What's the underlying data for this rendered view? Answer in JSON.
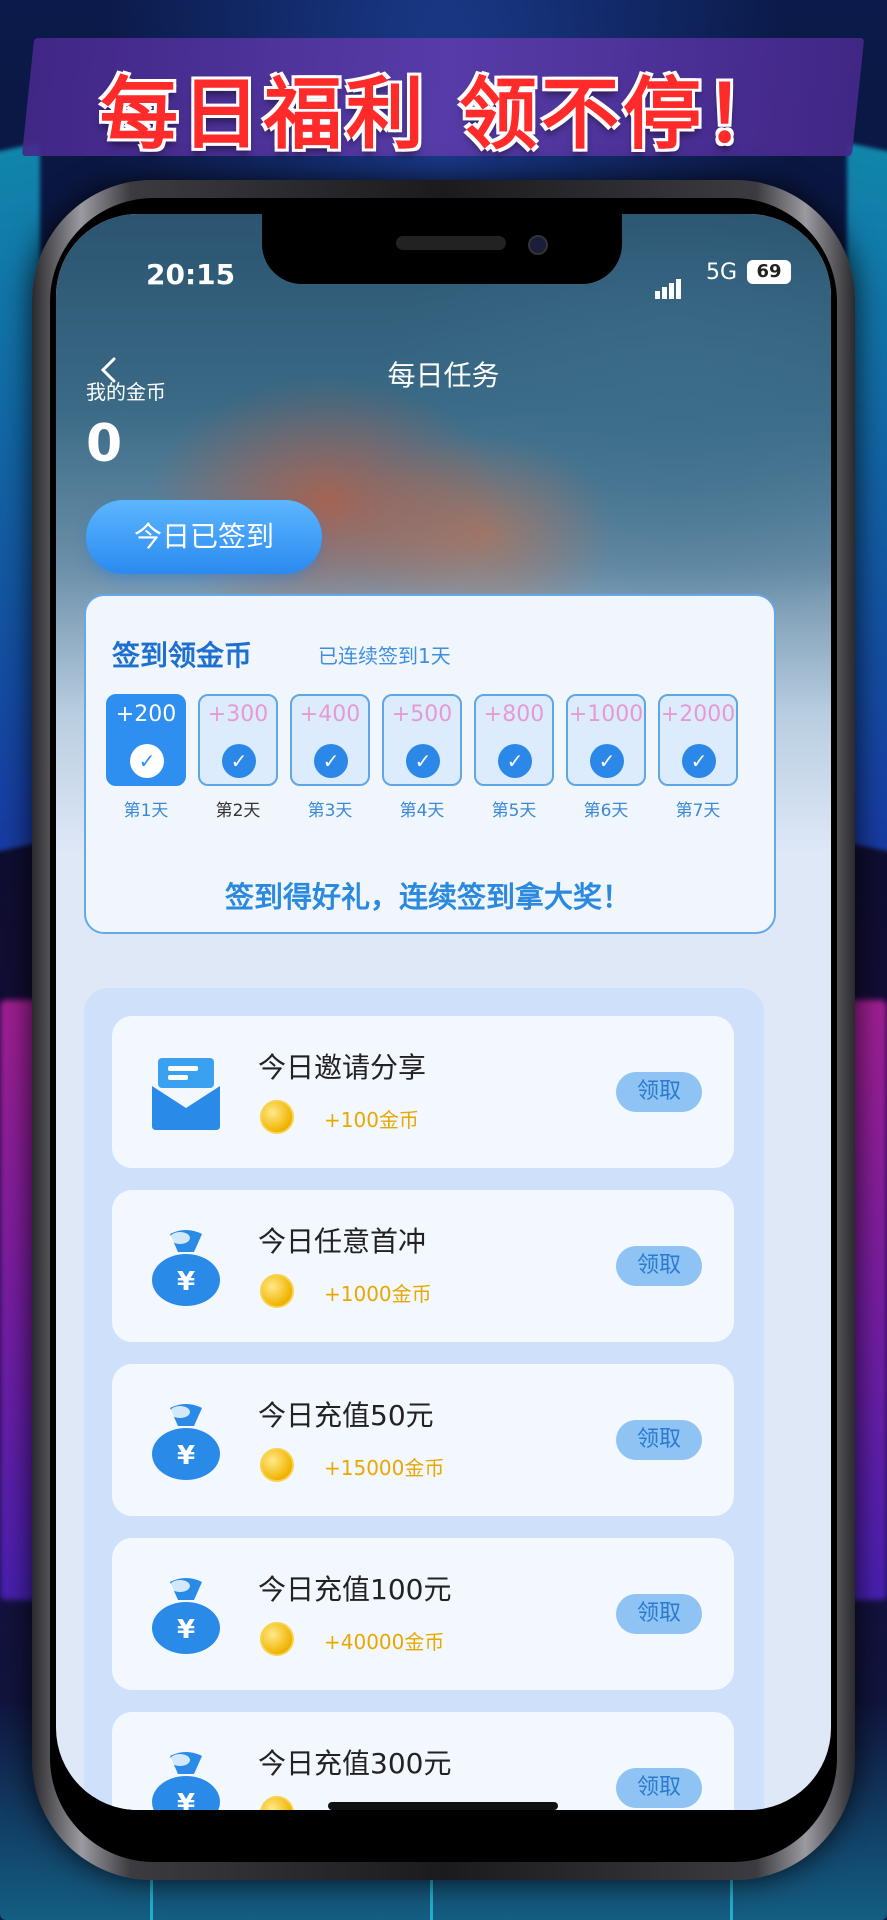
{
  "banner": {
    "title": "每日福利 领不停！"
  },
  "status": {
    "time": "20:15",
    "network": "5G",
    "battery": "69"
  },
  "header": {
    "title": "每日任务",
    "coin_label": "我的金币",
    "coin_value": "0",
    "checkin_button": "今日已签到"
  },
  "signin": {
    "title": "签到领金币",
    "subtitle": "已连续签到1天",
    "days": [
      {
        "amount": "+200",
        "label": "第1天"
      },
      {
        "amount": "+300",
        "label": "第2天"
      },
      {
        "amount": "+400",
        "label": "第3天"
      },
      {
        "amount": "+500",
        "label": "第4天"
      },
      {
        "amount": "+800",
        "label": "第5天"
      },
      {
        "amount": "+1000",
        "label": "第6天"
      },
      {
        "amount": "+2000",
        "label": "第7天"
      }
    ],
    "slogan": "签到得好礼，连续签到拿大奖！"
  },
  "tasks": [
    {
      "name": "今日邀请分享",
      "reward": "+100金币",
      "button": "领取",
      "icon": "mail-icon"
    },
    {
      "name": "今日任意首冲",
      "reward": "+1000金币",
      "button": "领取",
      "icon": "money-bag-icon"
    },
    {
      "name": "今日充值50元",
      "reward": "+15000金币",
      "button": "领取",
      "icon": "money-bag-icon"
    },
    {
      "name": "今日充值100元",
      "reward": "+40000金币",
      "button": "领取",
      "icon": "money-bag-icon"
    },
    {
      "name": "今日充值300元",
      "reward": "",
      "button": "领取",
      "icon": "money-bag-icon"
    }
  ],
  "colors": {
    "accent": "#2f8ff0",
    "reward": "#e8a800",
    "banner_text": "#ff2a2a"
  }
}
